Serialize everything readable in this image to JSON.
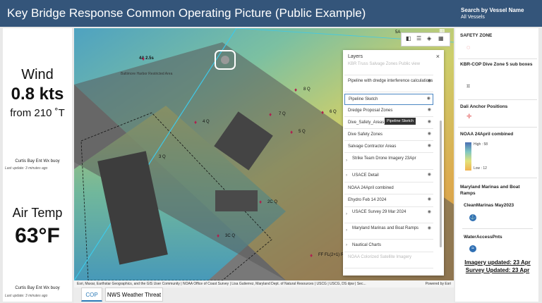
{
  "header": {
    "title": "Key Bridge Response Common Operating Picture (Public Example)"
  },
  "search": {
    "label": "Search by Vessel Name",
    "value": "All Vessels"
  },
  "wind": {
    "title": "Wind",
    "speed": "0.8 kts",
    "direction": "from 210 ˚T",
    "source": "Curtis Bay Ent Wx buoy",
    "updated": "Last update: 3 minutes ago"
  },
  "air_temp": {
    "title": "Air Temp",
    "value": "63°F",
    "source": "Curtis Bay Ent Wx buoy",
    "updated": "Last update: 3 minutes ago"
  },
  "map": {
    "attribution": "Esri, Maxar, Earthstar Geographics, and the GIS User Community | NOAA Office of Coast Survey | Lisa Gutierrez, Maryland Dept. of Natural Resources | USCG | USCG, DS dpw | Sec...",
    "powered_by": "Powered by Esri",
    "labels": [
      {
        "text": "4A 2.5s"
      },
      {
        "text": "8 Q"
      },
      {
        "text": "7 Q"
      },
      {
        "text": "4 Q"
      },
      {
        "text": "6 Q"
      },
      {
        "text": "5 Q"
      },
      {
        "text": "3 Q"
      },
      {
        "text": "2C Q"
      },
      {
        "text": "3C Q"
      },
      {
        "text": "FF FL(2+1) R"
      },
      {
        "text": "5A"
      },
      {
        "text": "Baltimore Harbor Restricted Area"
      }
    ]
  },
  "layers_panel": {
    "title": "Layers",
    "tooltip": "Pipeline Sketch",
    "items": [
      {
        "label": "KBR Truss Salvage Zones Public view",
        "dim": true,
        "eye": false,
        "chevron": false
      },
      {
        "label": "Pipeline with dredge interference calculations",
        "dim": false,
        "eye": true,
        "chevron": false
      },
      {
        "label": "Pipeline Sketch",
        "dim": false,
        "eye": true,
        "chevron": false,
        "selected": true
      },
      {
        "label": "Dredge Proposal Zones",
        "dim": false,
        "eye": true,
        "chevron": false
      },
      {
        "label": "Dive_Safety_Areas_JS",
        "dim": false,
        "eye": true,
        "chevron": false
      },
      {
        "label": "Dive Safety Zones",
        "dim": false,
        "eye": true,
        "chevron": false
      },
      {
        "label": "Salvage Contractor Areas",
        "dim": false,
        "eye": true,
        "chevron": false
      },
      {
        "label": "Strike Team Drone Imagery 23Apr",
        "dim": false,
        "eye": false,
        "chevron": true
      },
      {
        "label": "USACE Detail",
        "dim": false,
        "eye": true,
        "chevron": true
      },
      {
        "label": "NOAA 24April combined",
        "dim": false,
        "eye": false,
        "chevron": false
      },
      {
        "label": "Ehydro Feb 14 2024",
        "dim": false,
        "eye": true,
        "chevron": false
      },
      {
        "label": "USACE Survey 29 Mar 2024",
        "dim": false,
        "eye": true,
        "chevron": true
      },
      {
        "label": "Maryland Marinas and Boat Ramps",
        "dim": false,
        "eye": true,
        "chevron": true
      },
      {
        "label": "Nautical Charts",
        "dim": false,
        "eye": false,
        "chevron": true
      },
      {
        "label": "NOAA Colorized Satellite Imagery",
        "dim": true,
        "eye": false,
        "chevron": false
      }
    ]
  },
  "tabs": [
    {
      "label": "COP",
      "active": true
    },
    {
      "label": "NWS Weather Threat",
      "active": false
    }
  ],
  "right_panel": {
    "safety_zone": "SAFETY ZONE",
    "dive_zone": "KBR-COP Dive Zone 5 sub boxes",
    "dali_anchor": "Dali Anchor Positions",
    "noaa_title": "NOAA 24April combined",
    "legend_high": "High : 58",
    "legend_low": "Low : 12",
    "marinas_title": "Maryland Marinas and Boat Ramps",
    "clean_marinas": "CleanMarinas May2023",
    "water_access": "WaterAccessPnts",
    "imagery_updated": "Imagery updated: 23 Apr",
    "survey_updated": "Survey Updated: 23 Apr"
  },
  "colors": {
    "header_bg": "#34557a",
    "accent": "#2d7bb8",
    "symbol_red": "#e04b4b"
  }
}
